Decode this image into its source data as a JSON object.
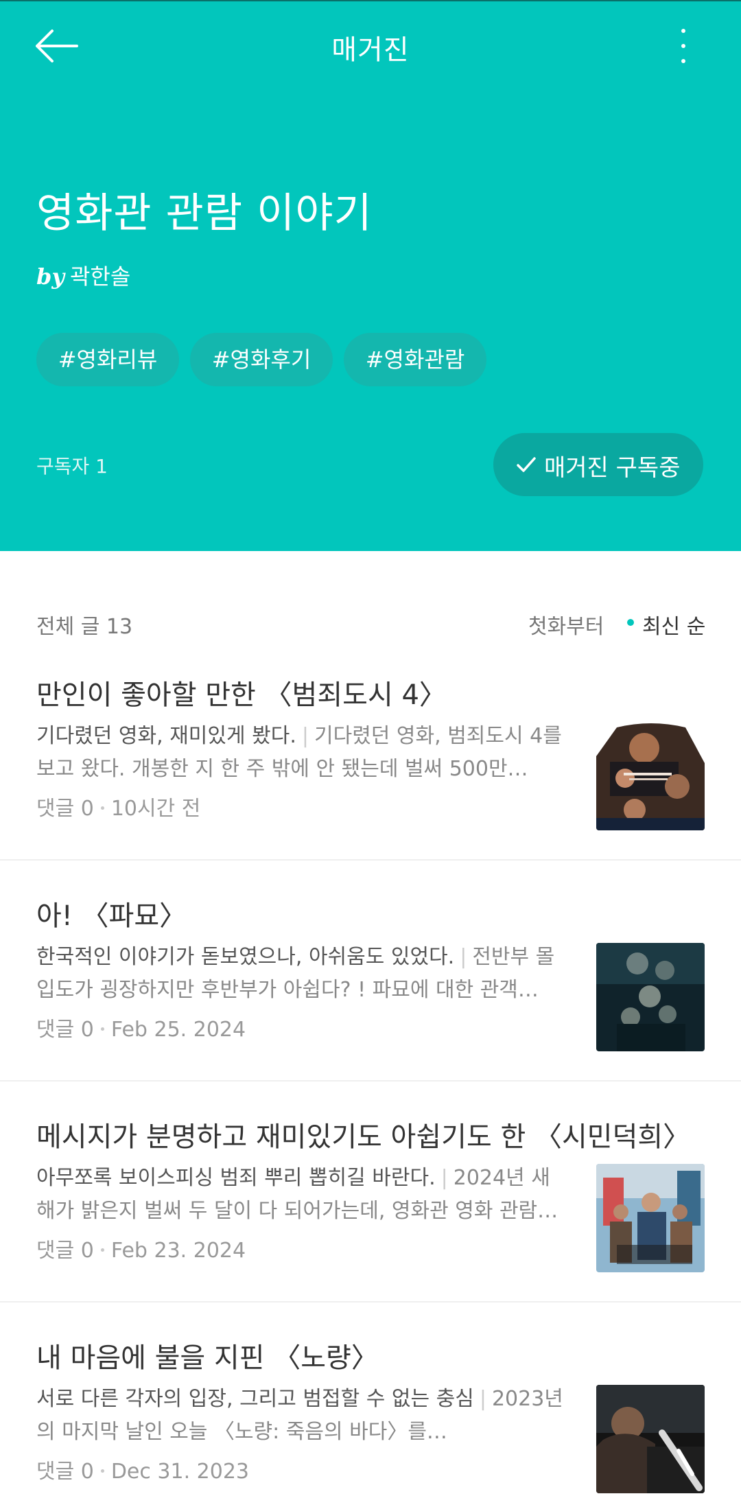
{
  "topbar": {
    "title": "매거진",
    "back_icon": "arrow-left-icon",
    "more_icon": "more-vertical-icon"
  },
  "magazine": {
    "title": "영화관 관람 이야기",
    "by": "by",
    "author": "곽한솔",
    "tags": [
      "#영화리뷰",
      "#영화후기",
      "#영화관람"
    ],
    "subscribers_label": "구독자 1",
    "subscribe_button": "매거진 구독중"
  },
  "list": {
    "total_label": "전체 글 13",
    "sort_first": "첫화부터",
    "sort_latest": "최신 순"
  },
  "posts": [
    {
      "title": "만인이 좋아할 만한 〈범죄도시 4〉",
      "subtitle": "기다렸던 영화, 재미있게 봤다.",
      "excerpt": "기다렸던 영화, 범죄도시 4를 보고 왔다. 개봉한 지 한 주 밖에 안 됐는데 벌써 500만…",
      "comments": "댓글 0",
      "date": "10시간 전"
    },
    {
      "title": "아! 〈파묘〉",
      "subtitle": "한국적인 이야기가 돋보였으나, 아쉬움도 있었다.",
      "excerpt": "전반부 몰입도가 굉장하지만 후반부가 아쉽다? ! 파묘에 대한 관객…",
      "comments": "댓글 0",
      "date": "Feb 25. 2024"
    },
    {
      "title": "메시지가 분명하고 재미있기도 아쉽기도 한 〈시민덕희〉",
      "subtitle": "아무쪼록 보이스피싱 범죄 뿌리 뽑히길 바란다.",
      "excerpt": "2024년 새해가 밝은지 벌써 두 달이 다 되어가는데, 영화관 영화 관람…",
      "comments": "댓글 0",
      "date": "Feb 23. 2024"
    },
    {
      "title": "내 마음에 불을 지핀 〈노량〉",
      "subtitle": "서로 다른 각자의 입장, 그리고 범접할 수 없는 충심",
      "excerpt": "2023년의 마지막 날인 오늘 〈노량: 죽음의 바다〉를…",
      "comments": "댓글 0",
      "date": "Dec 31. 2023"
    }
  ],
  "colors": {
    "accent": "#02c6bc",
    "tag_bg": "#14b7ae",
    "subscribe_bg": "#0aa8a0"
  }
}
